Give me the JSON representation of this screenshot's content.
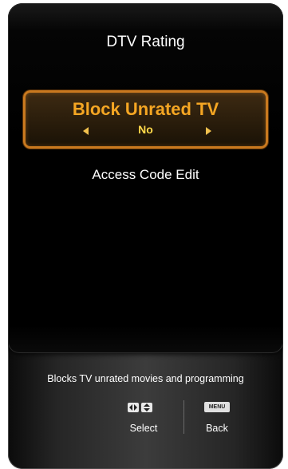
{
  "menu": {
    "title": "DTV Rating",
    "selected_item": {
      "label": "Block Unrated TV",
      "value": "No"
    },
    "items": [
      {
        "label": "Access Code Edit"
      }
    ]
  },
  "help": {
    "description": "Blocks TV unrated movies and programming"
  },
  "hints": {
    "select_label": "Select",
    "menu_key_label": "MENU",
    "back_label": "Back"
  },
  "icons": {
    "left_arrow": "left-arrow-icon",
    "right_arrow": "right-arrow-icon",
    "nav_keys": "directional-keys-icon",
    "menu_key": "menu-key-icon"
  },
  "colors": {
    "highlight_border": "#c9791f",
    "highlight_text": "#f5a623",
    "value_text": "#ffd84a",
    "text": "#ffffff",
    "background": "#000000"
  }
}
